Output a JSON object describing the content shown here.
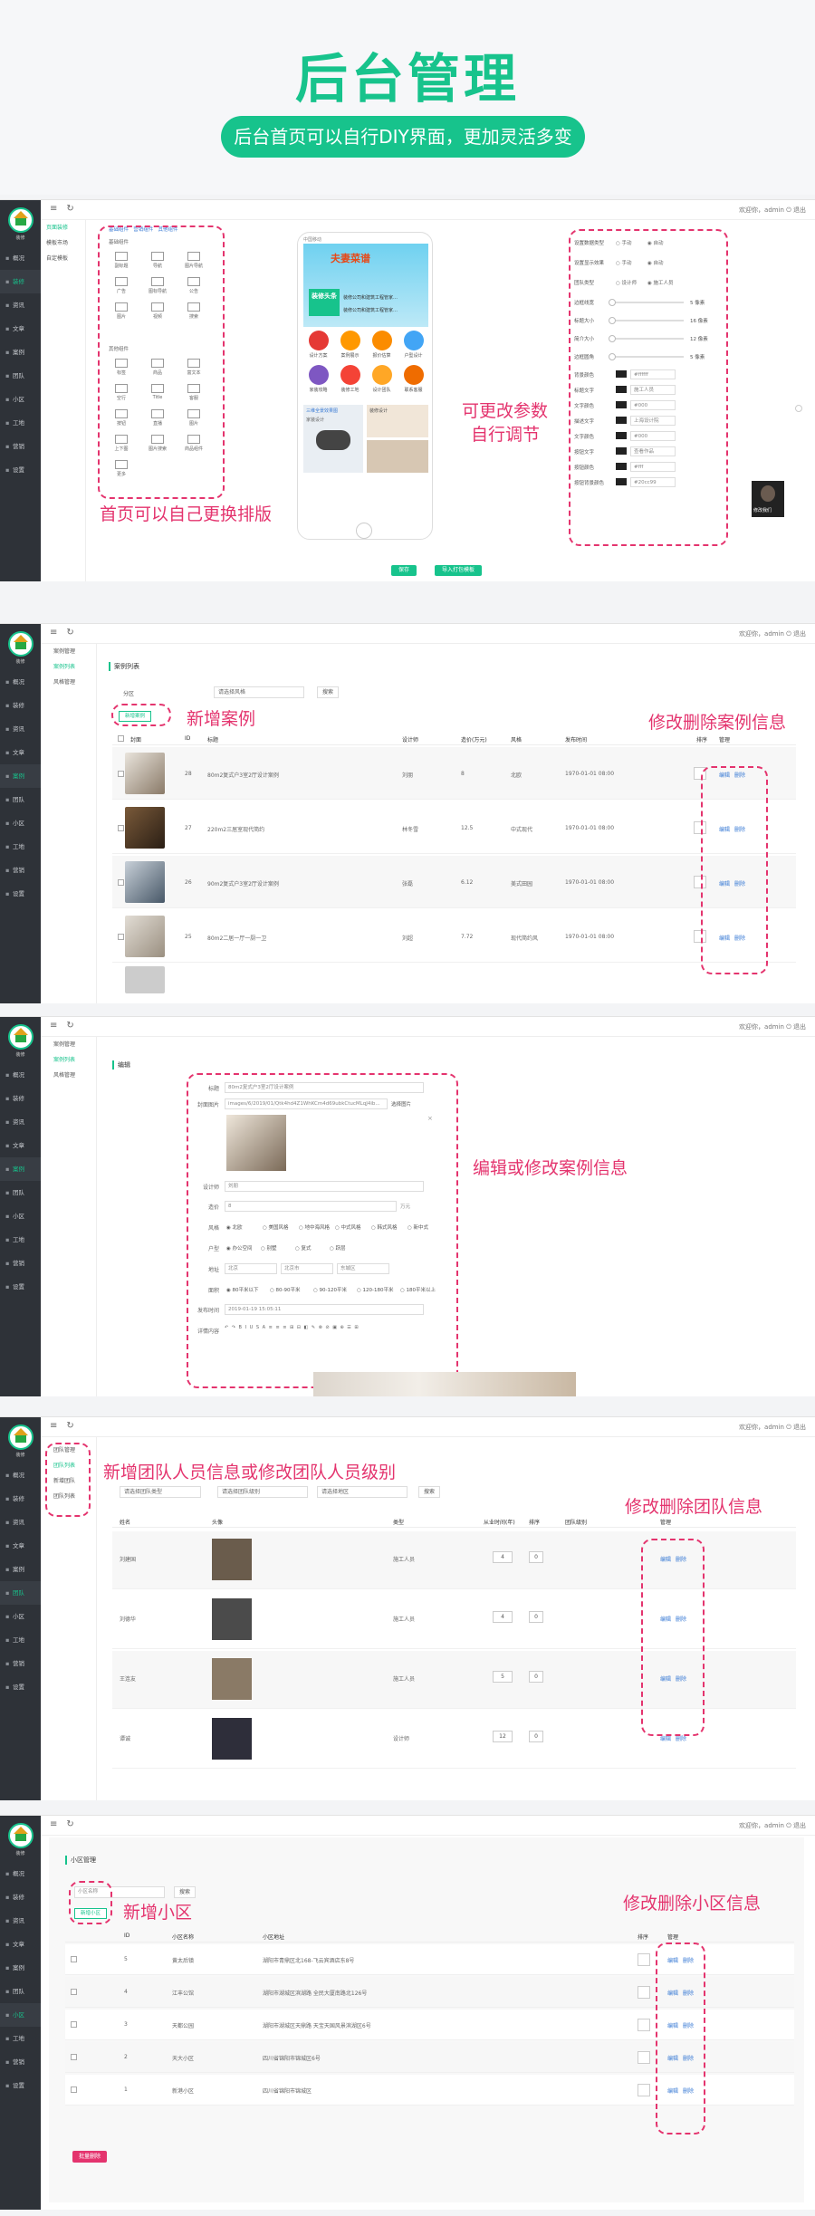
{
  "hero": {
    "title": "后台管理",
    "subtitle": "后台首页可以自行DIY界面，更加灵活多变"
  },
  "topbar": {
    "welcome": "欢迎你，admin",
    "logout": "退出"
  },
  "logo_text": "装修",
  "main_nav": [
    "概况",
    "装修",
    "资讯",
    "文章",
    "案例",
    "团队",
    "小区",
    "工地",
    "营销",
    "设置"
  ],
  "shots": {
    "diy": {
      "annotations": [
        "首页可以自己更换排版",
        "可更改参数",
        "自行调节"
      ],
      "subnav": [
        "页面装修",
        "模板市场",
        "自定模板"
      ],
      "components_tabs": [
        "基础组件",
        "营销组件",
        "其他组件"
      ],
      "components_group1": "基础组件",
      "components": [
        "副标题",
        "导航",
        "图片导航",
        "广告",
        "图标导航",
        "公告",
        "图片",
        "视频",
        "搜索"
      ],
      "components_group2": "其他组件",
      "components2": [
        "标签",
        "商品",
        "富文本",
        "空行",
        "Title",
        "客服",
        "按钮",
        "直播",
        "图片",
        "上下图",
        "图片搜索",
        "商品组件",
        "更多"
      ],
      "phone": {
        "status": "中国移动",
        "banner_title": "夫妻菜谱",
        "banner_sub": "装修头条",
        "news1": "装修公司和建筑工程管家…",
        "news2": "装修公司和建筑工程管家…",
        "icons": [
          "设计方案",
          "案例展示",
          "报价估算",
          "户型设计",
          "家装攻略",
          "装修工地",
          "设计团队",
          "联系客服"
        ],
        "ad_title": "三维全景效果图",
        "ad_sub": "家装设计",
        "ad2": "装修设计"
      },
      "props": {
        "rows": [
          {
            "label": "设置数据类型",
            "opt1": "手动",
            "opt2": "自动"
          },
          {
            "label": "设置显示效果",
            "opt1": "手动",
            "opt2": "自动"
          },
          {
            "label": "团队类型",
            "opt1": "设计师",
            "opt2": "施工人员"
          }
        ],
        "sliders": [
          {
            "label": "边框线宽",
            "value": "5 像素"
          },
          {
            "label": "标题大小",
            "value": "16 像素"
          },
          {
            "label": "简介大小",
            "value": "12 像素"
          },
          {
            "label": "边框圆角",
            "value": "5 像素"
          }
        ],
        "bg_label": "背景颜色",
        "bg_value": "#ffffff",
        "title_text_label": "标题文字",
        "title_text": "施工人员",
        "title_color_label": "文字颜色",
        "title_color": "#000",
        "desc_text_label": "描述文字",
        "desc_text": "上海设计院",
        "desc_color_label": "文字颜色",
        "desc_color": "#000",
        "btn_text_label": "按钮文字",
        "btn_text": "查看作品",
        "btn_bg_label": "按钮颜色",
        "btn_bg": "#fff",
        "btn_border_label": "按钮背景颜色",
        "btn_border": "#20cc99"
      },
      "preview_card": "修改我们",
      "footer_buttons": [
        "保存",
        "导入打包模板"
      ]
    },
    "cases": {
      "annotations": [
        "新增案例",
        "修改删除案例信息"
      ],
      "subnav": [
        "案例管理",
        "案例列表",
        "风格管理"
      ],
      "page_title": "案例列表",
      "filter_label": "分区",
      "filter_value": "请选择风格",
      "search": "搜索",
      "add_button": "新增案例",
      "columns": [
        "封面",
        "ID",
        "标题",
        "设计师",
        "造价(万元)",
        "风格",
        "发布时间",
        "排序",
        "管理"
      ],
      "rows": [
        {
          "id": "28",
          "title": "80m2复式户3室2厅设计案例",
          "designer": "刘朋",
          "cost": "8",
          "style": "北欧",
          "time": "1970-01-01 08:00"
        },
        {
          "id": "27",
          "title": "220m2三居室现代简约",
          "designer": "林冬雪",
          "cost": "12.5",
          "style": "中式现代",
          "time": "1970-01-01 08:00"
        },
        {
          "id": "26",
          "title": "90m2复式户3室2厅设计案例",
          "designer": "张磊",
          "cost": "6.12",
          "style": "美式田园",
          "time": "1970-01-01 08:00"
        },
        {
          "id": "25",
          "title": "80m2二居一厅一厨一卫",
          "designer": "刘超",
          "cost": "7.72",
          "style": "现代简约风",
          "time": "1970-01-01 08:00"
        }
      ],
      "actions": [
        "编辑",
        "删除"
      ]
    },
    "edit": {
      "annotation": "编辑或修改案例信息",
      "subnav": [
        "案例管理",
        "案例列表",
        "风格管理"
      ],
      "page_title": "编辑",
      "fields": {
        "title_label": "标题",
        "title_value": "80m2复式户3室2厅设计案例",
        "cover_label": "封面图片",
        "cover_value": "images/6/2019/01/Qtk4hd4Z1WhKCm4d69ubkCtucMLqJ4ib...",
        "cover_button": "选择图片",
        "designer_label": "设计师",
        "designer_value": "刘朋",
        "cost_label": "造价",
        "cost_value": "8",
        "cost_unit": "万元",
        "style_label": "风格",
        "styles": [
          "北欧",
          "美国风格",
          "地中海风格",
          "中式风格",
          "韩式风格",
          "新中式"
        ],
        "house_label": "户型",
        "houses": [
          "办公空间",
          "别墅",
          "复式",
          "跃层"
        ],
        "area_label": "地址",
        "city": "北京",
        "district": "北京市",
        "street": "东城区",
        "size_label": "面积",
        "sizes": [
          "80平米以下",
          "80-90平米",
          "90-120平米",
          "120-180平米",
          "180平米以上"
        ],
        "time_label": "发布时间",
        "time_value": "2019-01-19 15:05:11",
        "detail_label": "详情内容"
      }
    },
    "team": {
      "annotations": [
        "新增团队人员信息或修改团队人员级别",
        "修改删除团队信息"
      ],
      "subnav": [
        "团队管理",
        "团队列表",
        "新增团队",
        "团队列表"
      ],
      "filters": {
        "type": "请选择团队类型",
        "level": "请选择团队级别",
        "area": "请选择地区",
        "search": "搜索"
      },
      "columns": [
        "姓名",
        "头像",
        "类型",
        "从业时间(年)",
        "排序",
        "团队级别",
        "管理"
      ],
      "rows": [
        {
          "name": "刘建国",
          "type": "施工人员",
          "years": "4",
          "rank": "0"
        },
        {
          "name": "刘德华",
          "type": "施工人员",
          "years": "4",
          "rank": "0"
        },
        {
          "name": "王连友",
          "type": "施工人员",
          "years": "5",
          "rank": "0"
        },
        {
          "name": "谭诚",
          "type": "设计师",
          "years": "12",
          "rank": "0"
        }
      ],
      "actions": [
        "编辑",
        "删除"
      ]
    },
    "community": {
      "annotations": [
        "新增小区",
        "修改删除小区信息"
      ],
      "page_title": "小区管理",
      "search_placeholder": "小区名称",
      "search": "搜索",
      "add_button": "新增小区",
      "columns": [
        "ID",
        "小区名称",
        "小区地址",
        "排序",
        "管理"
      ],
      "rows": [
        {
          "id": "5",
          "name": "黄太后镇",
          "addr": "湖阳市青鼎区北168-飞云宾酒店东8号"
        },
        {
          "id": "4",
          "name": "江丰公馆",
          "addr": "湖阳市湖城区滨湖路 全民大厦南路北126号"
        },
        {
          "id": "3",
          "name": "天都公园",
          "addr": "湖阳市湖城区天鼎路 天宝天国风景滨湖区6号"
        },
        {
          "id": "2",
          "name": "天大小区",
          "addr": "四川省锦阳市锦城区6号"
        },
        {
          "id": "1",
          "name": "新港小区",
          "addr": "四川省锦阳市锦城区"
        }
      ],
      "actions": [
        "编辑",
        "删除"
      ],
      "batch_delete": "批量删除"
    }
  },
  "colors": {
    "brand": "#17c38c",
    "annotation": "#e4346e",
    "sidebar": "#2e3238"
  },
  "icons": [
    "menu-icon",
    "refresh-icon",
    "logout-icon"
  ]
}
